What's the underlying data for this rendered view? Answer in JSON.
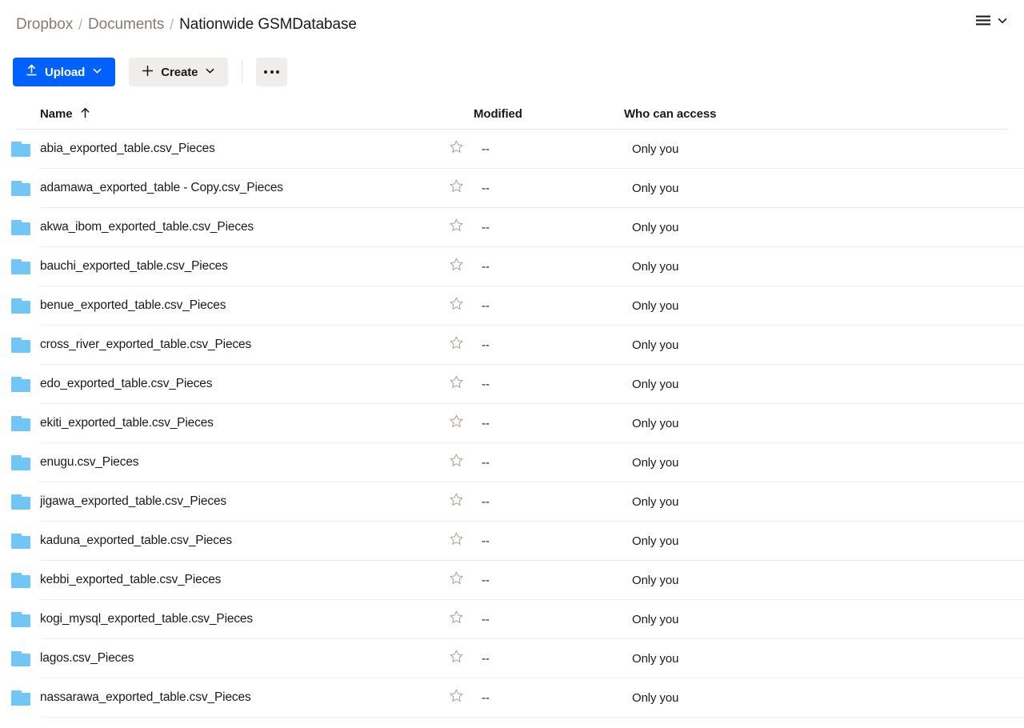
{
  "breadcrumb": {
    "items": [
      {
        "label": "Dropbox",
        "current": false
      },
      {
        "label": "Documents",
        "current": false
      },
      {
        "label": "Nationwide GSMDatabase",
        "current": true
      }
    ],
    "separator": "/"
  },
  "view_controls": {
    "list_view_icon": "list-view-icon",
    "chevron_icon": "chevron-down-icon"
  },
  "toolbar": {
    "upload_label": "Upload",
    "upload_icon": "upload-arrow-icon",
    "upload_chevron": "chevron-down-icon",
    "create_label": "Create",
    "create_icon": "plus-icon",
    "create_chevron": "chevron-down-icon",
    "more_label": "•••",
    "more_icon": "ellipsis-icon",
    "accent_color": "#0061fe",
    "secondary_button_color": "#f0eeec"
  },
  "table": {
    "columns": {
      "name": "Name",
      "sort_arrow": "↑",
      "modified": "Modified",
      "access": "Who can access"
    },
    "sort": {
      "column": "Name",
      "direction": "ascending"
    },
    "rows": [
      {
        "name": "abia_exported_table.csv_Pieces",
        "icon": "folder-icon",
        "starred": false,
        "modified": "--",
        "access": "Only you"
      },
      {
        "name": "adamawa_exported_table - Copy.csv_Pieces",
        "icon": "folder-icon",
        "starred": false,
        "modified": "--",
        "access": "Only you"
      },
      {
        "name": "akwa_ibom_exported_table.csv_Pieces",
        "icon": "folder-icon",
        "starred": false,
        "modified": "--",
        "access": "Only you"
      },
      {
        "name": "bauchi_exported_table.csv_Pieces",
        "icon": "folder-icon",
        "starred": false,
        "modified": "--",
        "access": "Only you"
      },
      {
        "name": "benue_exported_table.csv_Pieces",
        "icon": "folder-icon",
        "starred": false,
        "modified": "--",
        "access": "Only you"
      },
      {
        "name": "cross_river_exported_table.csv_Pieces",
        "icon": "folder-icon",
        "starred": false,
        "modified": "--",
        "access": "Only you"
      },
      {
        "name": "edo_exported_table.csv_Pieces",
        "icon": "folder-icon",
        "starred": false,
        "modified": "--",
        "access": "Only you"
      },
      {
        "name": "ekiti_exported_table.csv_Pieces",
        "icon": "folder-icon",
        "starred": false,
        "modified": "--",
        "access": "Only you"
      },
      {
        "name": "enugu.csv_Pieces",
        "icon": "folder-icon",
        "starred": false,
        "modified": "--",
        "access": "Only you"
      },
      {
        "name": "jigawa_exported_table.csv_Pieces",
        "icon": "folder-icon",
        "starred": false,
        "modified": "--",
        "access": "Only you"
      },
      {
        "name": "kaduna_exported_table.csv_Pieces",
        "icon": "folder-icon",
        "starred": false,
        "modified": "--",
        "access": "Only you"
      },
      {
        "name": "kebbi_exported_table.csv_Pieces",
        "icon": "folder-icon",
        "starred": false,
        "modified": "--",
        "access": "Only you"
      },
      {
        "name": "kogi_mysql_exported_table.csv_Pieces",
        "icon": "folder-icon",
        "starred": false,
        "modified": "--",
        "access": "Only you"
      },
      {
        "name": "lagos.csv_Pieces",
        "icon": "folder-icon",
        "starred": false,
        "modified": "--",
        "access": "Only you"
      },
      {
        "name": "nassarawa_exported_table.csv_Pieces",
        "icon": "folder-icon",
        "starred": false,
        "modified": "--",
        "access": "Only you"
      }
    ]
  },
  "colors": {
    "folder": "#71c6f5",
    "brand_blue": "#0061fe",
    "text": "#1e1919",
    "muted_text": "#867c73",
    "row_divider": "#f0eeec"
  }
}
